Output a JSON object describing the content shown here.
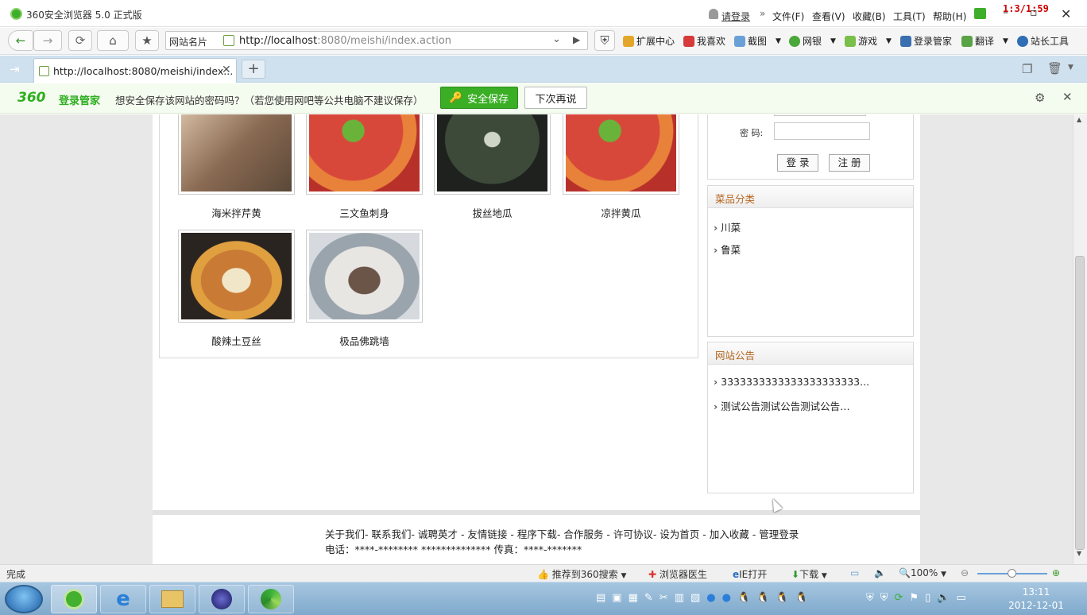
{
  "window": {
    "title": "360安全浏览器 5.0 正式版",
    "login_link": "请登录",
    "menus": [
      "文件(F)",
      "查看(V)",
      "收藏(B)",
      "工具(T)",
      "帮助(H)"
    ],
    "overlay_timer": "1:3/1:59"
  },
  "navbar": {
    "site_cards": "网站名片",
    "url_host": "http://localhost",
    "url_rest": ":8080/meishi/index.action",
    "tools": [
      "扩展中心",
      "我喜欢",
      "截图",
      "网银",
      "游戏",
      "登录管家",
      "翻译",
      "站长工具"
    ]
  },
  "tabs": {
    "active_title": "http://localhost:8080/meishi/index..."
  },
  "password_bar": {
    "brand": "360",
    "brand_suffix": "登录管家",
    "message": "想安全保存该网站的密码吗？（若您使用网吧等公共电脑不建议保存）",
    "save_label": "安全保存",
    "later_label": "下次再说"
  },
  "dishes": [
    {
      "name": "海米拌芹黄",
      "color": "#8a6a52"
    },
    {
      "name": "三文鱼刺身",
      "color": "#c8402a"
    },
    {
      "name": "拔丝地瓜",
      "color": "#3d4a3a"
    },
    {
      "name": "凉拌黄瓜",
      "color": "#c8402a"
    },
    {
      "name": "酸辣土豆丝",
      "color": "#c97a35"
    },
    {
      "name": "极品佛跳墙",
      "color": "#9aa4ad"
    }
  ],
  "login": {
    "password_label": "密  码:",
    "login_button": "登 录",
    "register_button": "注 册"
  },
  "categories": {
    "title": "菜品分类",
    "items": [
      "川菜",
      "鲁菜"
    ]
  },
  "notices": {
    "title": "网站公告",
    "items": [
      "3333333333333333333333...",
      "测试公告测试公告测试公告…"
    ]
  },
  "footer": {
    "links": "关于我们- 联系我们- 诚聘英才 - 友情链接 - 程序下载- 合作服务 - 许可协议- 设为首页 - 加入收藏 - 管理登录",
    "contact": "电话：****-******** ************** 传真：****-*******"
  },
  "statusbar": {
    "status": "完成",
    "recommend": "推荐到360搜索",
    "doctor": "浏览器医生",
    "ie_open": "IE打开",
    "download": "下载",
    "zoom": "100%"
  },
  "taskbar": {
    "time": "13:11",
    "date": "2012-12-01"
  }
}
